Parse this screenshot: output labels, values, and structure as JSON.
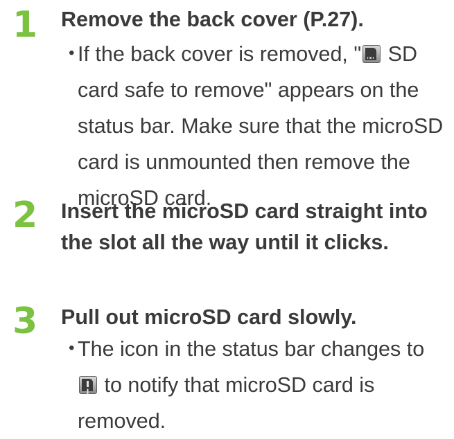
{
  "steps": [
    {
      "number": "1",
      "title": "Remove the back cover (P.27).",
      "note": {
        "bullet": "・",
        "text_before_icon": "If the back cover is removed, \"",
        "icon": "sd-card-safe-to-remove-icon",
        "text_after_icon": " SD card safe to remove\" appears on the status bar. Make sure that the microSD card is unmounted then remove the microSD card."
      }
    },
    {
      "number": "2",
      "title": "Insert the microSD card straight into the slot all the way until it clicks."
    },
    {
      "number": "3",
      "title": "Pull out microSD card slowly.",
      "note": {
        "bullet": "・",
        "text_before_icon": "The icon in the status bar changes to ",
        "icon": "sd-card-removed-icon",
        "text_after_icon": " to notify that microSD card is removed."
      }
    }
  ],
  "colors": {
    "step_number": "#7cc242",
    "text": "#3a3a3a"
  }
}
